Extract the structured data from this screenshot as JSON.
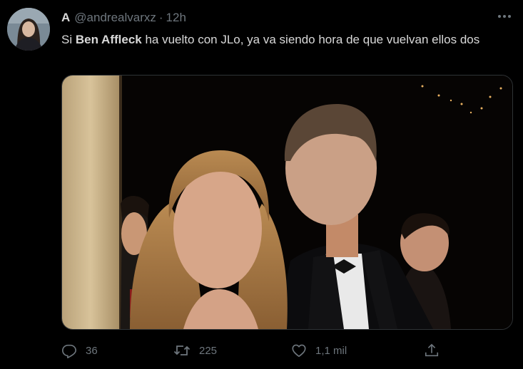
{
  "tweet": {
    "author": {
      "display_name": "A",
      "handle": "@andrealvarxz",
      "avatar_icon": "user-avatar"
    },
    "separator": "·",
    "time": "12h",
    "text_parts": [
      "Si ",
      "Ben Affleck",
      " ha vuelto con JLo, ya va siendo hora de que vuelvan ellos dos"
    ],
    "media": {
      "icon": "photo"
    },
    "actions": {
      "reply": {
        "icon": "reply-icon",
        "count": "36"
      },
      "retweet": {
        "icon": "retweet-icon",
        "count": "225"
      },
      "like": {
        "icon": "heart-icon",
        "count": "1,1 mil"
      },
      "share": {
        "icon": "share-icon"
      }
    },
    "more_icon": "more-icon"
  },
  "colors": {
    "background": "#000000",
    "text": "#d9d9d9",
    "secondary": "#6e767d",
    "border": "#2f3336"
  }
}
